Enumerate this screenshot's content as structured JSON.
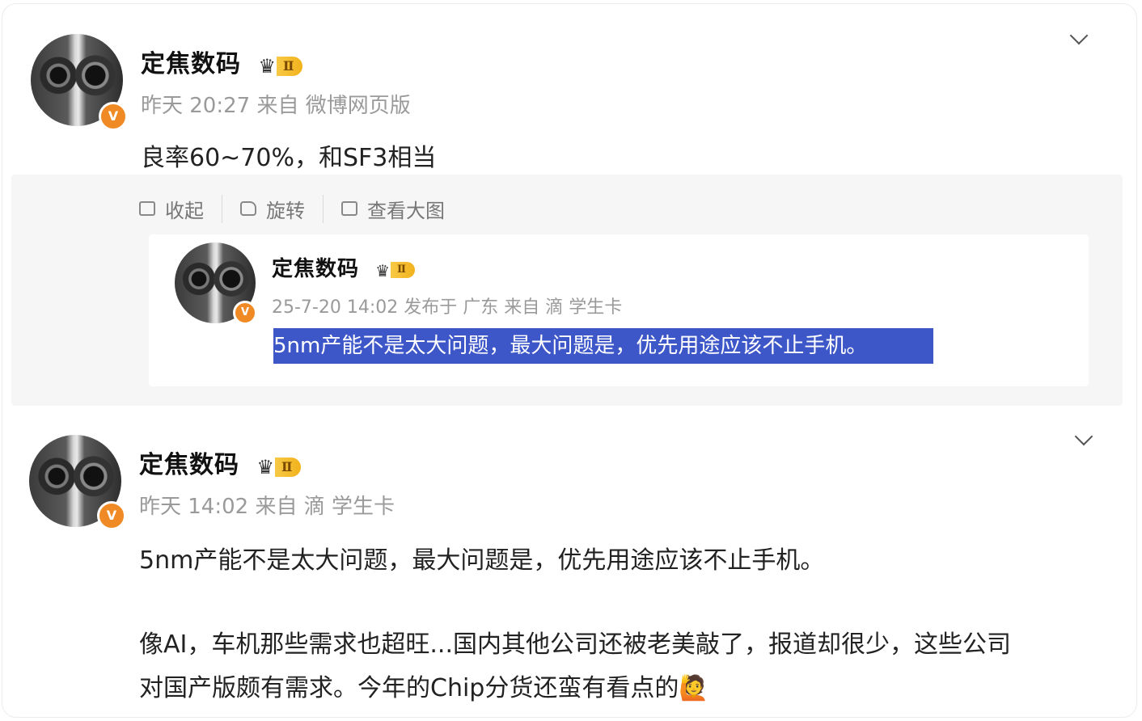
{
  "post1": {
    "author": "定焦数码",
    "level": "Ⅱ",
    "meta": "昨天 20:27 来自 微博网页版",
    "text": "良率60~70%，和SF3相当"
  },
  "quote_actions": {
    "collapse": "收起",
    "rotate": "旋转",
    "view_large": "查看大图"
  },
  "quoted": {
    "author": "定焦数码",
    "level": "Ⅱ",
    "meta": "25-7-20 14:02 发布于 广东 来自 滴 学生卡",
    "text": "5nm产能不是太大问题，最大问题是，优先用途应该不止手机。"
  },
  "post2": {
    "author": "定焦数码",
    "level": "Ⅱ",
    "meta": "昨天 14:02 来自 滴 学生卡",
    "text1": "5nm产能不是太大问题，最大问题是，优先用途应该不止手机。",
    "text2_line1": "像AI，车机那些需求也超旺...国内其他公司还被老美敲了，报道却很少，这些公司",
    "text2_line2": "对国产版颇有需求。今年的Chip分货还蛮有看点的",
    "emoji": "🙋"
  },
  "colors": {
    "highlight": "#3d56c8",
    "vip_gold": "#f2b21c",
    "verified_orange": "#f08a24"
  }
}
